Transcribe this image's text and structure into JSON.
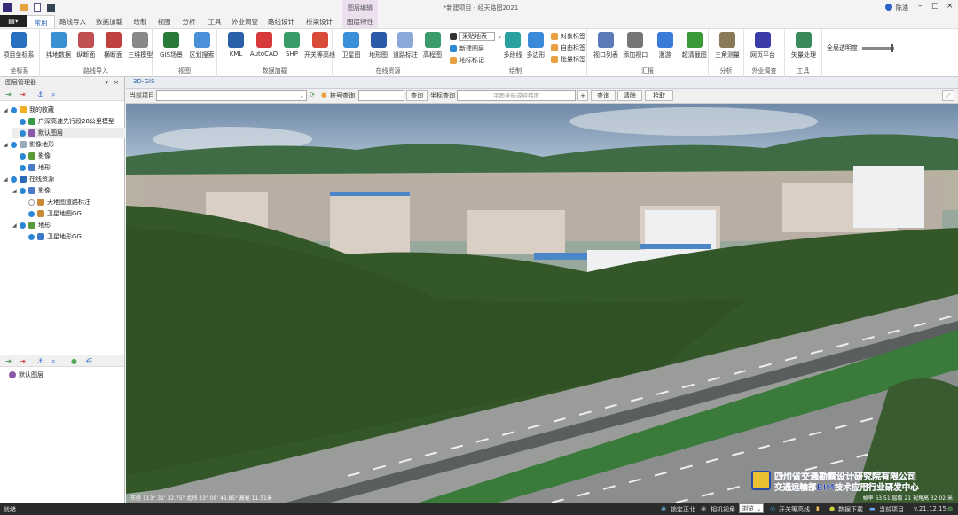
{
  "title": "*新建项目 - 经天路图2021",
  "user": "陈浩",
  "window_controls": {
    "minimize": "–",
    "maximize": "□",
    "close": "×"
  },
  "context_tab_group": "图层编辑",
  "tabs": [
    "常用",
    "路线导入",
    "数据加载",
    "绘制",
    "视图",
    "分析",
    "工具",
    "外业调查",
    "路线设计",
    "桥梁设计",
    "图层特性"
  ],
  "active_tab": "常用",
  "ribbon": {
    "groups": [
      {
        "label": "坐标系",
        "buttons": [
          "项目坐标系"
        ]
      },
      {
        "label": "路线导入",
        "buttons": [
          "纬地数据",
          "纵断面",
          "横断面",
          "三维模型"
        ]
      },
      {
        "label": "视图",
        "buttons": [
          "GIS场景",
          "区划搜索"
        ]
      },
      {
        "label": "数据加载",
        "buttons": [
          "KML",
          "AutoCAD",
          "SHP",
          "开关等高线"
        ]
      },
      {
        "label": "在线资源",
        "buttons": [
          "卫星图",
          "地形图",
          "道路标注",
          "高程图"
        ]
      },
      {
        "label": "绘制",
        "select_value": "采贴地表",
        "small": [
          "新建图层",
          "地标标记"
        ],
        "buttons": [
          "多段线",
          "多边形"
        ],
        "labels": [
          "对象标签",
          "自由标签",
          "批量标签"
        ]
      },
      {
        "label": "汇报",
        "buttons": [
          "视口列表",
          "添加视口",
          "漫游",
          "超清截图"
        ]
      },
      {
        "label": "分析",
        "buttons": [
          "三角测量"
        ]
      },
      {
        "label": "外业调查",
        "buttons": [
          "网页平台"
        ]
      },
      {
        "label": "工具",
        "buttons": [
          "矢量处理"
        ]
      }
    ],
    "transparency_label": "全局透明度",
    "transparency_value": 0.95
  },
  "layer_manager": {
    "title": "图层管理器",
    "tree": [
      {
        "label": "我的收藏",
        "level": 0,
        "color": "#f0b020"
      },
      {
        "label": "广深高速先行段28公里模型",
        "level": 1,
        "color": "#3a9a4a"
      },
      {
        "label": "默认图层",
        "level": 1,
        "color": "#8a5aa8"
      },
      {
        "label": "影像地形",
        "level": 0,
        "color": "#9ab"
      },
      {
        "label": "影像",
        "level": 1,
        "color": "#5a9a3a"
      },
      {
        "label": "地形",
        "level": 1,
        "color": "#4a7ac8"
      },
      {
        "label": "在线资源",
        "level": 0,
        "color": "#2a6ab8"
      },
      {
        "label": "影像",
        "level": 1,
        "color": "#4a7ac8"
      },
      {
        "label": "天地图道路标注",
        "level": 2,
        "color": "#c88a3a"
      },
      {
        "label": "卫星地图GG",
        "level": 2,
        "color": "#c88a3a"
      },
      {
        "label": "地形",
        "level": 1,
        "color": "#5a9a3a"
      },
      {
        "label": "卫星地形GG",
        "level": 2,
        "color": "#3a7ac8"
      }
    ],
    "bottom_item": "默认图层"
  },
  "view_tab": "3D-GIS",
  "search": {
    "project_label": "当前项目",
    "project_value": "",
    "station_label": "桩号查询",
    "station_value": "",
    "query1": "查询",
    "coord_label": "坐标查询",
    "coord_placeholder": "平面坐标或经纬度",
    "plus": "+",
    "query2": "查询",
    "clear": "清除",
    "pick": "拾取"
  },
  "overlay": {
    "coords": "东经 113° 31' 32.75\" 北纬 23° 08' 46.85\" 高程 11.51米",
    "logo_line1": "四川省交通勘察设计研究院有限公司",
    "logo_line2": "交通运输部BIM技术应用行业研发中心",
    "fps": "帧率 63.51  层级 21  视角高 32.02 米"
  },
  "status": {
    "ready": "就绪",
    "lock_north": "锁定正北",
    "camera_view": "相机视角",
    "camera_mode": "浏览",
    "contour": "开关等高线",
    "download": "数据下载",
    "current_project": "当前项目",
    "version": "v.21.12.15"
  }
}
